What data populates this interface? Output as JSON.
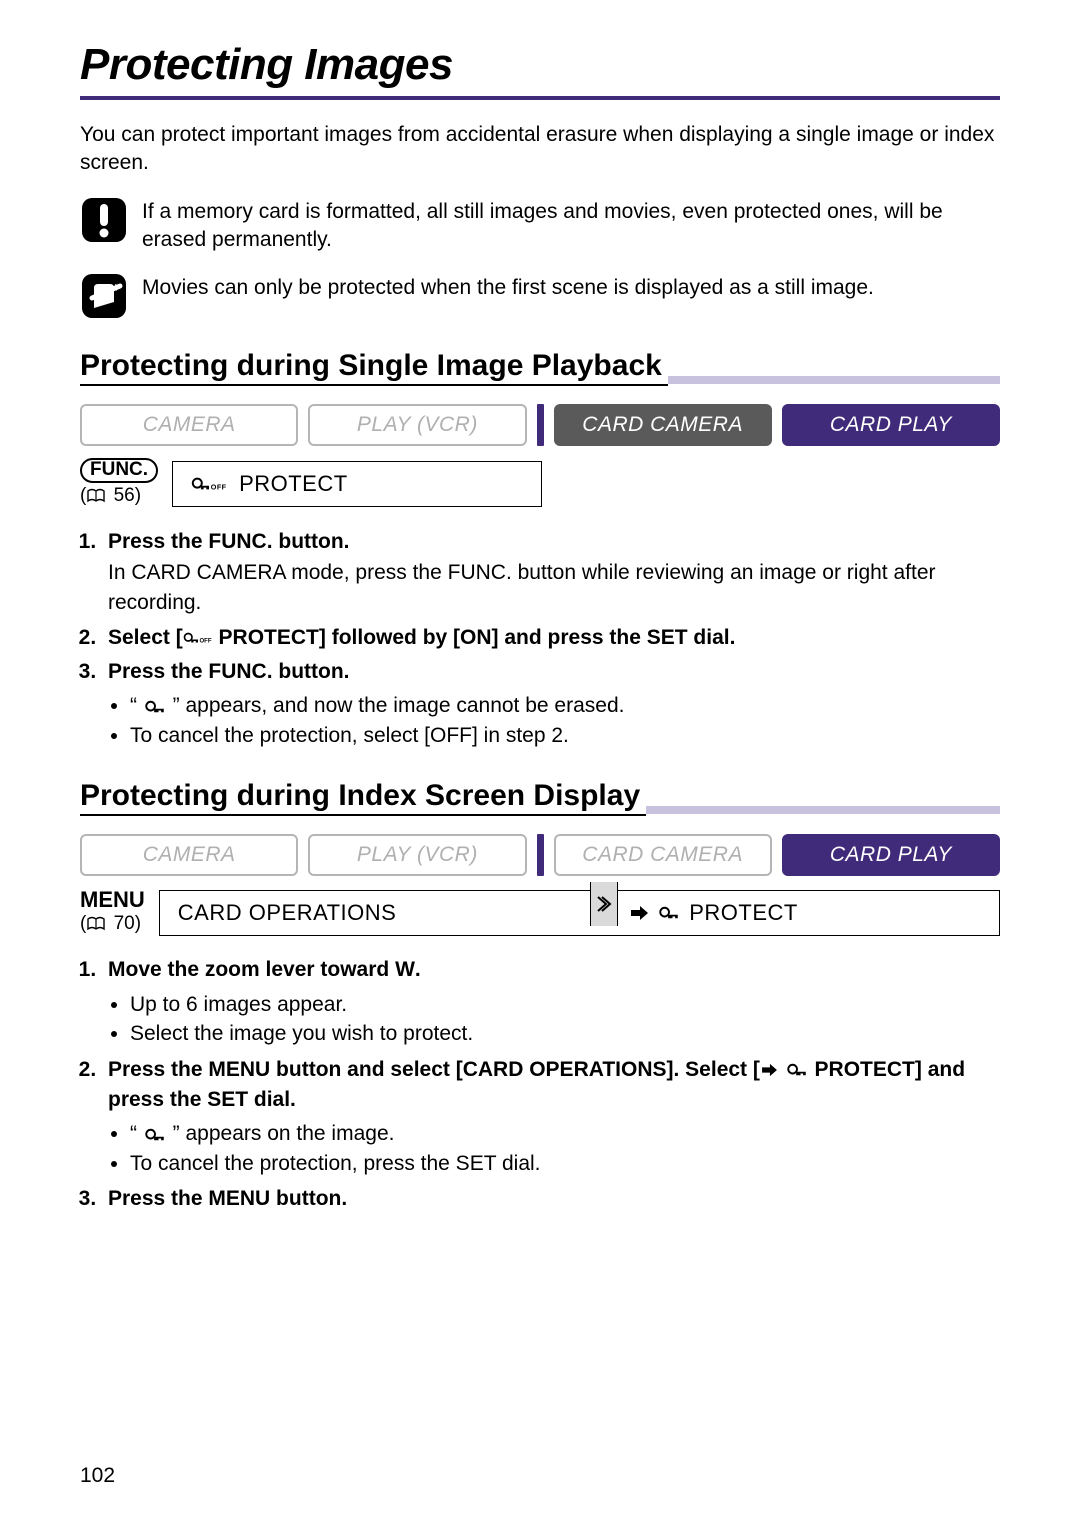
{
  "page": {
    "title": "Protecting Images",
    "intro": "You can protect important images from accidental erasure when displaying a single image or index screen.",
    "page_number": "102"
  },
  "notes": {
    "warning": "If a memory card is formatted, all still images and movies, even protected ones, will be erased permanently.",
    "info": "Movies can only be protected when the first scene is displayed as a still image."
  },
  "section1": {
    "heading": "Protecting during Single Image Playback",
    "modes": [
      "CAMERA",
      "PLAY (VCR)",
      "CARD CAMERA",
      "CARD PLAY"
    ],
    "func_label": "FUNC.",
    "func_ref": "56",
    "setting_label": "PROTECT",
    "steps": {
      "s1_title": "Press the FUNC. button.",
      "s1_body": "In CARD CAMERA mode, press the FUNC. button while reviewing an image or right after recording.",
      "s2_title_a": "Select [",
      "s2_title_b": " PROTECT] followed by [ON] and press the SET dial.",
      "s3_title": "Press the FUNC. button.",
      "s3_bullets": {
        "b1a": "“ ",
        "b1b": " ” appears, and now the image cannot be erased.",
        "b2": "To cancel the protection, select [OFF] in step 2."
      }
    }
  },
  "section2": {
    "heading": "Protecting during Index Screen Display",
    "modes": [
      "CAMERA",
      "PLAY (VCR)",
      "CARD CAMERA",
      "CARD PLAY"
    ],
    "menu_label": "MENU",
    "menu_ref": "70",
    "path1": "CARD OPERATIONS",
    "path2": "PROTECT",
    "steps": {
      "s1_title_a": "Move the zoom lever toward ",
      "s1_title_b": "W",
      "s1_title_c": ".",
      "s1_bullets": {
        "b1": "Up to 6 images appear.",
        "b2": "Select the image you wish to protect."
      },
      "s2_title_a": "Press the MENU button and select [CARD OPERATIONS]. Select [",
      "s2_title_b": " PROTECT] and press the SET dial.",
      "s2_bullets": {
        "b1a": "“ ",
        "b1b": " ” appears on the image.",
        "b2": "To cancel the protection, press the SET dial."
      },
      "s3_title": "Press the MENU button."
    }
  }
}
